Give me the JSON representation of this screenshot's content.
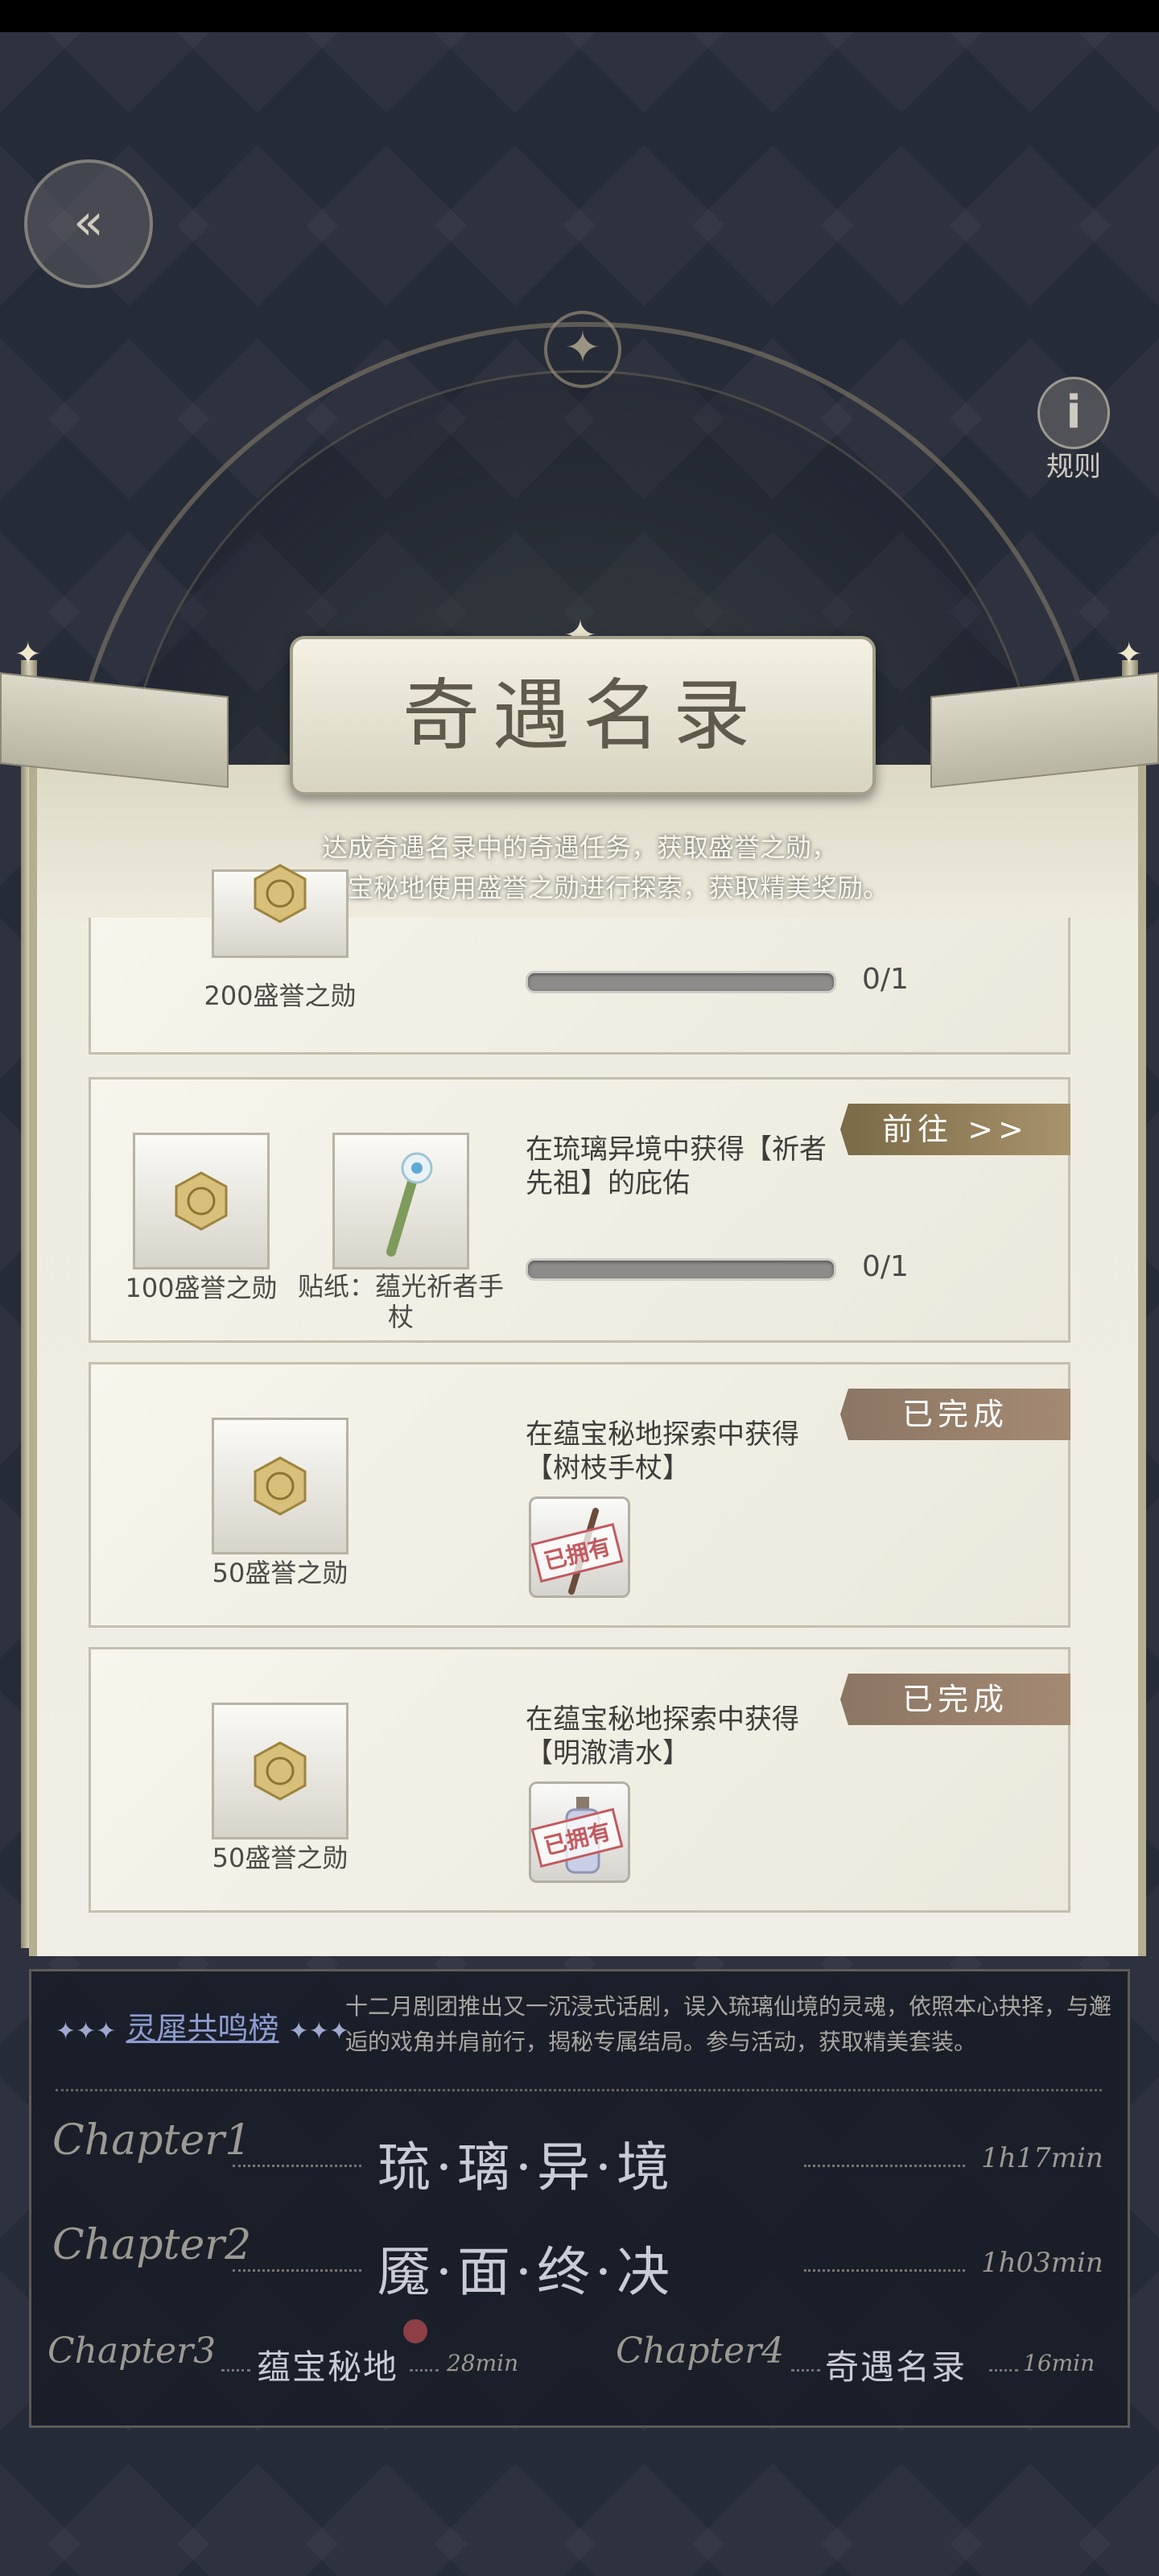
{
  "header": {
    "back_icon": "back-arrow-icon",
    "rules_label": "规则",
    "rules_icon_char": "i"
  },
  "banner": {
    "title": "奇遇名录"
  },
  "description": {
    "line1": "达成奇遇名录中的奇遇任务，获取盛誉之勋，",
    "line2": "前往蕴宝秘地使用盛誉之勋进行探索，获取精美奖励。"
  },
  "tasks": [
    {
      "rewards": [
        {
          "label": "200盛誉之勋"
        }
      ],
      "progress": "0/1",
      "progress_fraction": 0
    },
    {
      "rewards": [
        {
          "label": "100盛誉之勋"
        },
        {
          "label": "贴纸：蕴光祈者手杖"
        }
      ],
      "text": "在琉璃异境中获得【祈者先祖】的庇佑",
      "progress": "0/1",
      "progress_fraction": 0,
      "button": "前往 >>"
    },
    {
      "rewards": [
        {
          "label": "50盛誉之勋"
        }
      ],
      "text": "在蕴宝秘地探索中获得【树枝手杖】",
      "owned": "已拥有",
      "button": "已完成"
    },
    {
      "rewards": [
        {
          "label": "50盛誉之勋"
        }
      ],
      "text": "在蕴宝秘地探索中获得【明澈清水】",
      "owned": "已拥有",
      "button": "已完成"
    }
  ],
  "bottom": {
    "tag": "灵犀共鸣榜",
    "tag_decor": "✦✦✦",
    "desc": "十二月剧团推出又一沉浸式话剧，误入琉璃仙境的灵魂，依照本心抉择，与邂逅的戏角并肩前行，揭秘专属结局。参与活动，获取精美套装。",
    "chapters": [
      {
        "label": "Chapter1",
        "title": "琉·璃·异·境",
        "time": "1h17min"
      },
      {
        "label": "Chapter2",
        "title": "魇·面·终·决",
        "time": "1h03min"
      },
      {
        "label": "Chapter3",
        "title": "蕴宝秘地",
        "time": "28min"
      },
      {
        "label": "Chapter4",
        "title": "奇遇名录",
        "time": "16min"
      }
    ]
  },
  "colors": {
    "gold": "#a8936b",
    "done": "#a48a73",
    "stamp": "#c25a5f",
    "panel": "#191d28",
    "tag": "#8d9dd0"
  }
}
